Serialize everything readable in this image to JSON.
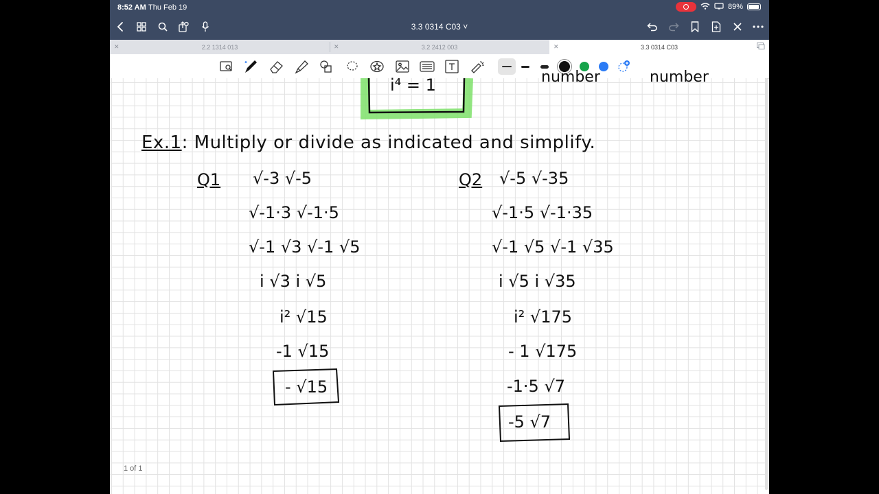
{
  "status": {
    "time": "8:52 AM",
    "date": "Thu Feb 19",
    "battery": "89%"
  },
  "nav": {
    "doc_title": "3.3 0314 C03 ˅"
  },
  "tabs": [
    {
      "label": "2.2 1314 013",
      "active": false
    },
    {
      "label": "3.2 2412 003",
      "active": false
    },
    {
      "label": "3.3 0314 C03",
      "active": true
    }
  ],
  "toolbar": {
    "active_color": "#111111",
    "colors": [
      "#444444",
      "#222222",
      "#111111",
      "#16a34a",
      "#2b7bf5"
    ]
  },
  "notes": {
    "top_box": "i⁴ = 1",
    "top_right_a": "number",
    "top_right_b": "number",
    "ex_label": "Ex.1",
    "ex_text": ": Multiply or divide as indicated and simplify.",
    "q1": {
      "label": "Q1",
      "steps": [
        "√-3  √-5",
        "√-1·3  √-1·5",
        "√-1 √3 √-1 √5",
        "i √3  i √5",
        "i² √15",
        "-1 √15"
      ],
      "answer": "- √15"
    },
    "q2": {
      "label": "Q2",
      "steps": [
        "√-5  √-35",
        "√-1·5  √-1·35",
        "√-1  √5  √-1 √35",
        "i √5  i √35",
        "i² √175",
        "- 1 √175",
        "-1·5 √7"
      ],
      "answer": "-5 √7"
    }
  },
  "footer": {
    "page_indicator": "1 of 1"
  }
}
